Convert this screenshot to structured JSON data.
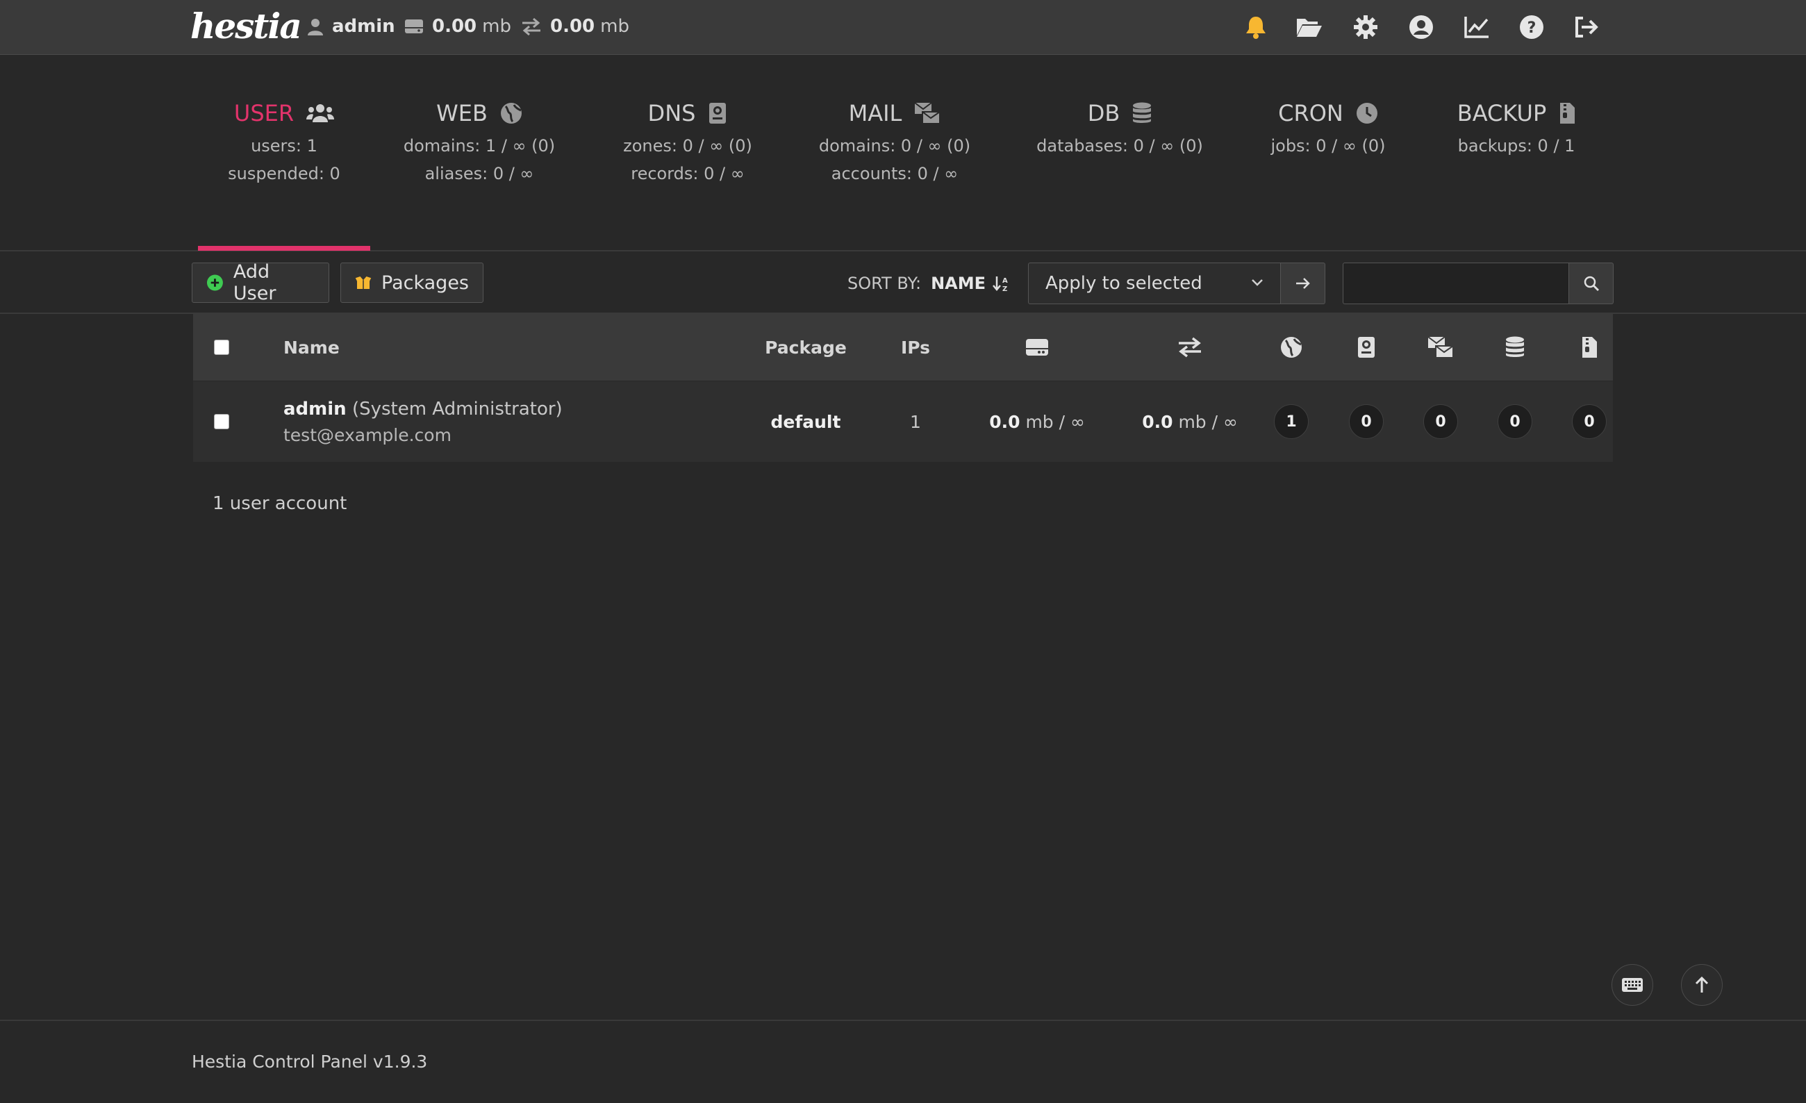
{
  "topbar": {
    "logo": "hestia",
    "user": "admin",
    "disk_value": "0.00",
    "disk_unit": "mb",
    "bandwidth_value": "0.00",
    "bandwidth_unit": "mb",
    "accent": "#e2336b",
    "bell_color": "#f7b731",
    "icons": [
      "bell-icon",
      "folder-open-icon",
      "gear-icon",
      "user-circle-icon",
      "chart-line-icon",
      "question-icon",
      "logout-icon"
    ]
  },
  "stats": [
    {
      "label": "USER",
      "icon": "users-icon",
      "line1": "users: 1",
      "line2": "suspended: 0"
    },
    {
      "label": "WEB",
      "icon": "globe-icon",
      "line1": "domains: 1 / ∞ (0)",
      "line2": "aliases: 0 / ∞"
    },
    {
      "label": "DNS",
      "icon": "address-book-icon",
      "line1": "zones: 0 / ∞ (0)",
      "line2": "records: 0 / ∞"
    },
    {
      "label": "MAIL",
      "icon": "mail-bulk-icon",
      "line1": "domains: 0 / ∞ (0)",
      "line2": "accounts: 0 / ∞"
    },
    {
      "label": "DB",
      "icon": "database-icon",
      "line1": "databases: 0 / ∞ (0)",
      "line2": ""
    },
    {
      "label": "CRON",
      "icon": "clock-icon",
      "line1": "jobs: 0 / ∞ (0)",
      "line2": ""
    },
    {
      "label": "BACKUP",
      "icon": "file-zipper-icon",
      "line1": "backups: 0 / 1",
      "line2": ""
    }
  ],
  "toolbar": {
    "add_user": "Add User",
    "packages": "Packages",
    "sort_by": "SORT BY:",
    "sort_field": "NAME",
    "bulk_action": "Apply to selected",
    "search_placeholder": ""
  },
  "table": {
    "headers": {
      "name": "Name",
      "package": "Package",
      "ips": "IPs"
    },
    "rows": [
      {
        "username": "admin",
        "fullname": "(System Administrator)",
        "email": "test@example.com",
        "package": "default",
        "ips": "1",
        "disk_value": "0.0",
        "disk_unit": "mb / ∞",
        "bw_value": "0.0",
        "bw_unit": "mb / ∞",
        "web": "1",
        "dns": "0",
        "mail": "0",
        "db": "0",
        "backup": "0"
      }
    ]
  },
  "summary": "1 user account",
  "footer": "Hestia Control Panel v1.9.3"
}
